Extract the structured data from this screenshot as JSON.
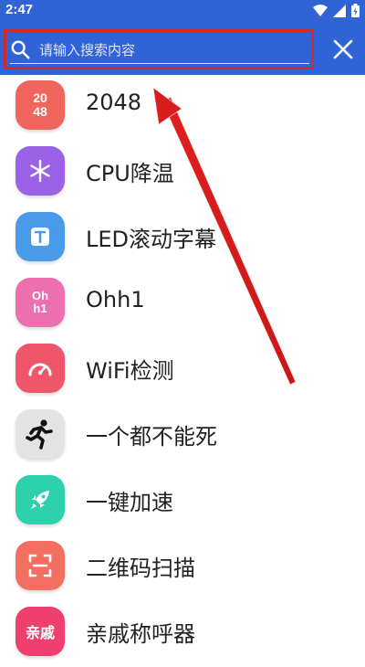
{
  "status_bar": {
    "time": "2:47"
  },
  "search": {
    "placeholder": "请输入搜索内容",
    "value": ""
  },
  "colors": {
    "toolbar": "#2f63d6",
    "highlight": "#d42a2a"
  },
  "apps": [
    {
      "name": "2048",
      "icon": "2048-icon",
      "icon_lines": [
        "20",
        "48"
      ],
      "color": "#f0665f"
    },
    {
      "name": "CPU降温",
      "icon": "snowflake-icon",
      "color": "#9b62e8"
    },
    {
      "name": "LED滚动字幕",
      "icon": "text-icon",
      "color": "#4a9aea"
    },
    {
      "name": "Ohh1",
      "icon": "ohh1-icon",
      "icon_lines": [
        "Oh",
        "h1"
      ],
      "color": "#ee6fb0"
    },
    {
      "name": "WiFi检测",
      "icon": "speedometer-icon",
      "color": "#f0566a"
    },
    {
      "name": "一个都不能死",
      "icon": "running-man-icon",
      "color": "#e3e3e3"
    },
    {
      "name": "一键加速",
      "icon": "rocket-icon",
      "color": "#2fd1ad"
    },
    {
      "name": "二维码扫描",
      "icon": "qr-scan-icon",
      "color": "#f36f62"
    },
    {
      "name": "亲戚称呼器",
      "icon": "relatives-icon",
      "icon_text": "亲戚",
      "color": "#ef3f6f"
    }
  ]
}
